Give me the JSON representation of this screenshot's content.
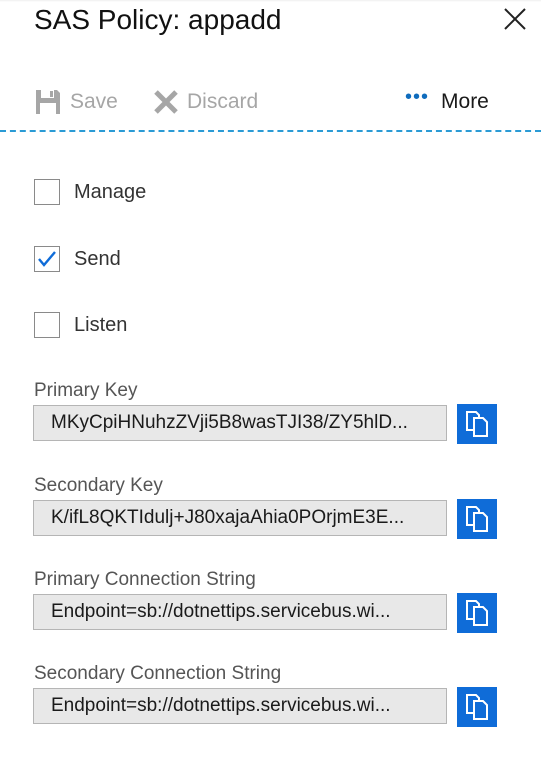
{
  "blade": {
    "title": "SAS Policy: appadd"
  },
  "toolbar": {
    "save_label": "Save",
    "discard_label": "Discard",
    "more_dots": "•••",
    "more_label": "More"
  },
  "permissions": [
    {
      "label": "Manage",
      "checked": false
    },
    {
      "label": "Send",
      "checked": true
    },
    {
      "label": "Listen",
      "checked": false
    }
  ],
  "fields": [
    {
      "label": "Primary Key",
      "value": "MKyCpiHNuhzZVji5B8wasTJI38/ZY5hlD..."
    },
    {
      "label": "Secondary Key",
      "value": "K/ifL8QKTIdulj+J80xajaAhia0POrjmE3E..."
    },
    {
      "label": "Primary Connection String",
      "value": "Endpoint=sb://dotnettips.servicebus.wi..."
    },
    {
      "label": "Secondary Connection String",
      "value": "Endpoint=sb://dotnettips.servicebus.wi..."
    }
  ],
  "colors": {
    "accent": "#0f6cd8",
    "separator": "#2a9bd5",
    "disabled_text": "#a6a6a6"
  },
  "icons": {
    "close": "close-icon",
    "save": "save-icon",
    "discard": "discard-icon",
    "copy": "copy-icon",
    "checkmark": "checkmark-icon"
  }
}
